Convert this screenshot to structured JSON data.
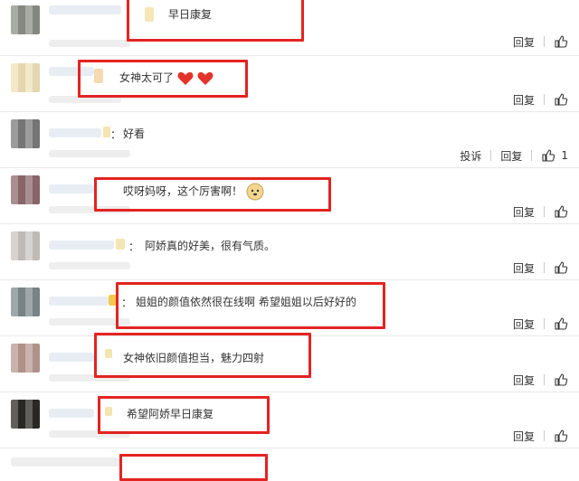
{
  "comments": [
    {
      "text": "早日康复",
      "actions": [
        "回复"
      ],
      "likes": ""
    },
    {
      "text": "女神太可了",
      "actions": [
        "回复"
      ],
      "likes": ""
    },
    {
      "text": "好看",
      "actions": [
        "投诉",
        "回复"
      ],
      "likes": "1"
    },
    {
      "text": "哎呀妈呀，这个厉害啊！",
      "actions": [
        "回复"
      ],
      "likes": ""
    },
    {
      "text": "阿娇真的好美，很有气质。",
      "actions": [
        "回复"
      ],
      "likes": ""
    },
    {
      "text": "姐姐的颜值依然很在线啊 希望姐姐以后好好的",
      "actions": [
        "回复"
      ],
      "likes": ""
    },
    {
      "text": "女神依旧颜值担当，魅力四射",
      "actions": [
        "回复"
      ],
      "likes": ""
    },
    {
      "text": "希望阿娇早日康复",
      "actions": [
        "回复"
      ],
      "likes": ""
    }
  ],
  "colors": {
    "highlight": "#e32421",
    "heart": "#e4332a"
  },
  "icons": [
    "thumbs-up-icon",
    "heart-icon",
    "doge-emoji-icon"
  ],
  "colon": "："
}
